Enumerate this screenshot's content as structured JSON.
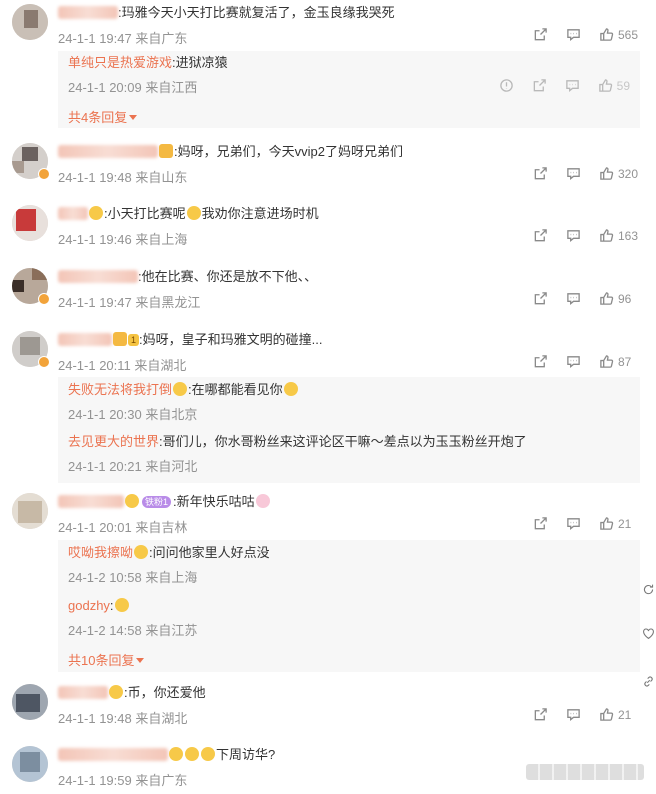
{
  "comments": [
    {
      "username": "",
      "text": ":玛雅今天小天打比赛就复活了，金玉良缘我哭死",
      "date": "24-1-1 19:47",
      "location": "来自广东",
      "likes": "565",
      "replies": [
        {
          "username": "单纯只是热爱游戏",
          "text": ":进狱凉猿",
          "date": "24-1-1 20:09",
          "location": "来自江西",
          "likes": "59"
        }
      ],
      "more": "共4条回复"
    },
    {
      "username": "",
      "text": ":妈呀，兄弟们，今天vvip2了妈呀兄弟们",
      "date": "24-1-1 19:48",
      "location": "来自山东",
      "likes": "320"
    },
    {
      "username": "",
      "text": ":小天打比赛呢",
      "text2": "我劝你注意进场时机",
      "date": "24-1-1 19:46",
      "location": "来自上海",
      "likes": "163"
    },
    {
      "username": "",
      "text": ":他在比赛、你还是放不下他、、",
      "date": "24-1-1 19:47",
      "location": "来自黑龙江",
      "likes": "96"
    },
    {
      "username": "",
      "level": "1",
      "text": ":妈呀，皇子和玛雅文明的碰撞...",
      "date": "24-1-1 20:11",
      "location": "来自湖北",
      "likes": "87",
      "replies": [
        {
          "username": "失败无法将我打倒",
          "text": ":在哪都能看见你",
          "date": "24-1-1 20:30",
          "location": "来自北京"
        },
        {
          "username": "去见更大的世界",
          "text": ":哥们儿，你水哥粉丝来这评论区干嘛～差点以为玉玉粉丝开炮了",
          "date": "24-1-1 20:21",
          "location": "来自河北"
        }
      ]
    },
    {
      "username": "",
      "tag": "铁粉1",
      "text": ":新年快乐咕咕",
      "date": "24-1-1 20:01",
      "location": "来自吉林",
      "likes": "21",
      "replies": [
        {
          "username": "哎呦我擦呦",
          "text": ":问问他家里人好点没",
          "date": "24-1-2 10:58",
          "location": "来自上海"
        },
        {
          "username": "godzhy",
          "text": ":",
          "date": "24-1-2 14:58",
          "location": "来自江苏"
        }
      ],
      "more": "共10条回复"
    },
    {
      "username": "",
      "text": ":币，你还爱他",
      "date": "24-1-1 19:48",
      "location": "来自湖北",
      "likes": "21"
    },
    {
      "username": "",
      "text": "下周访华?",
      "date": "24-1-1 19:59",
      "location": "来自广东",
      "likes": ""
    }
  ],
  "icons": {
    "share": "share-icon",
    "comment": "comment-icon",
    "like": "thumbs-up-icon",
    "report": "report-icon"
  },
  "colors": {
    "username": "#eb7350",
    "meta": "#939393",
    "reply_bg": "#f7f7f7"
  }
}
